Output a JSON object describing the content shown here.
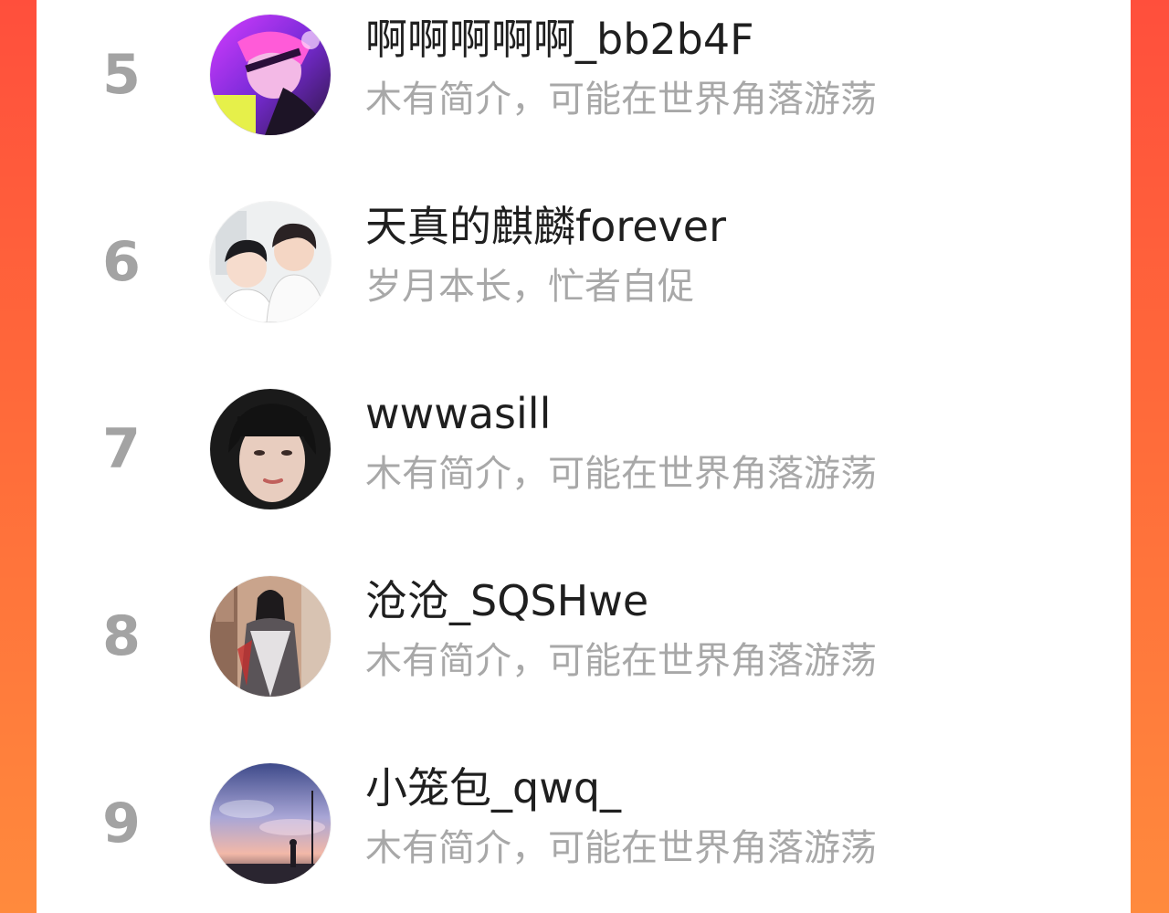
{
  "colors": {
    "background_gradient_top": "#ff4f3c",
    "background_gradient_bottom": "#ff8a3d",
    "panel": "#ffffff",
    "rank": "#a3a3a3",
    "name": "#1f1f1f",
    "bio": "#a8a8a8"
  },
  "ranking": {
    "items": [
      {
        "rank": "5",
        "name": "啊啊啊啊啊_bb2b4F",
        "bio": "木有简介，可能在世界角落游荡",
        "avatar": "anime-avatar-purple-neon"
      },
      {
        "rank": "6",
        "name": "天真的麒麟forever",
        "bio": "岁月本长，忙者自促",
        "avatar": "anime-avatar-two-boys"
      },
      {
        "rank": "7",
        "name": "wwwasill",
        "bio": "木有简介，可能在世界角落游荡",
        "avatar": "photo-avatar-girl-bangs"
      },
      {
        "rank": "8",
        "name": "沧沧_SQSHwe",
        "bio": "木有简介，可能在世界角落游荡",
        "avatar": "anime-avatar-robed-figure"
      },
      {
        "rank": "9",
        "name": "小笼包_qwq_",
        "bio": "木有简介，可能在世界角落游荡",
        "avatar": "illustration-avatar-sky-sunset"
      }
    ]
  }
}
